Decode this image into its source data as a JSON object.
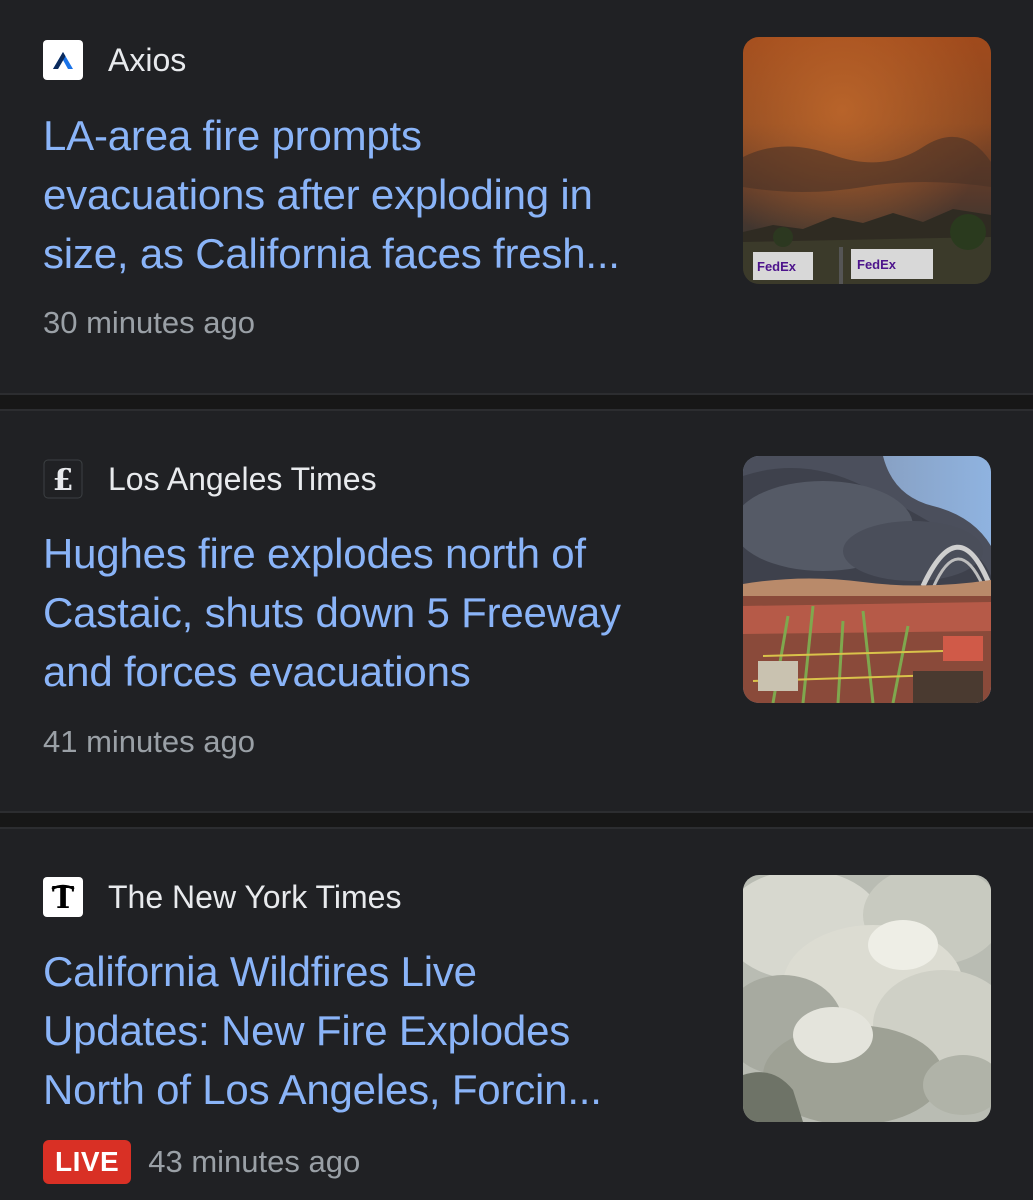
{
  "articles": [
    {
      "source": "Axios",
      "logo_icon": "axios-logo-icon",
      "headline_lines": [
        "LA-area fire prompts",
        "evacuations after exploding in",
        "size, as California faces fresh..."
      ],
      "timestamp": "30 minutes ago",
      "thumbnail_signs": [
        "FedEx",
        "FedEx"
      ]
    },
    {
      "source": "Los Angeles Times",
      "logo_icon": "la-times-logo-icon",
      "headline_lines": [
        "Hughes fire explodes north of",
        "Castaic, shuts down 5 Freeway",
        "and forces evacuations"
      ],
      "timestamp": "41 minutes ago"
    },
    {
      "source": "The New York Times",
      "logo_icon": "nyt-logo-icon",
      "headline_lines": [
        "California Wildfires Live",
        "Updates: New Fire Explodes",
        "North of Los Angeles, Forcin..."
      ],
      "timestamp": "43 minutes ago",
      "badge": "LIVE"
    }
  ],
  "colors": {
    "background": "#202124",
    "headline": "#8ab4f8",
    "source_text": "#e8eaed",
    "timestamp": "#9aa0a6",
    "live_badge": "#d93025"
  }
}
